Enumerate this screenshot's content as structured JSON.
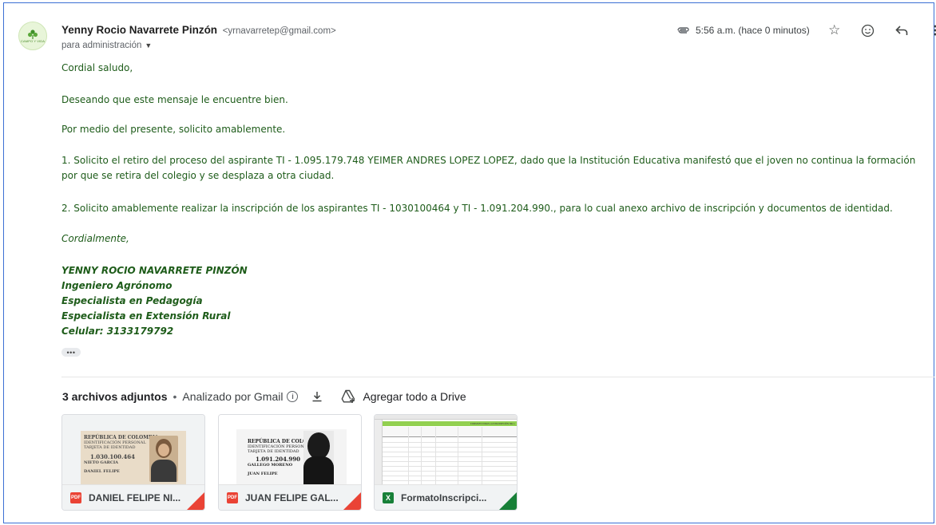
{
  "sender": {
    "name": "Yenny Rocio Navarrete Pinzón",
    "email": "<yrnavarretep@gmail.com>",
    "to": "para administración",
    "avatar_text": "CAMPO Y VIDA"
  },
  "header": {
    "time": "5:56 a.m. (hace 0 minutos)",
    "icons": [
      "attachment-icon",
      "star-icon",
      "emoji-icon",
      "reply-icon",
      "more-vert-icon"
    ]
  },
  "body": {
    "greeting": "Cordial saludo,",
    "line2": "Deseando que este mensaje le encuentre bien.",
    "line3": "Por medio del presente, solicito amablemente.",
    "item1": "1. Solicito el retiro del proceso del aspirante TI - 1.095.179.748 YEIMER ANDRES LOPEZ LOPEZ, dado que la Institución Educativa  manifestó que el joven no continua la formación por que se retira del colegio y se desplaza a otra ciudad.",
    "item2": "2. Solicito amablemente realizar la inscripción de los aspirantes TI - 1030100464 y TI - 1.091.204.990., para lo cual anexo archivo de inscripción y documentos de identidad.",
    "closing": "Cordialmente,",
    "signature": [
      "YENNY ROCIO NAVARRETE PINZÓN",
      "Ingeniero Agrónomo",
      "Especialista en Pedagogía",
      "Especialista en Extensión Rural",
      "Celular: 3133179792"
    ],
    "trimmed": "•••"
  },
  "attachments": {
    "count_label": "3 archivos adjuntos",
    "separator": "•",
    "scanned_label": "Analizado por Gmail",
    "drive_label": "Agregar todo a Drive",
    "files": [
      {
        "name": "DANIEL FELIPE NI...",
        "type": "PDF",
        "thumb_lines": [
          "REPÚBLICA DE COLOMBIA",
          "IDENTIFICACIÓN PERSONAL",
          "TARJETA DE IDENTIDAD",
          "1.030.100.464",
          "NIETO GARCIA",
          "DANIEL FELIPE"
        ]
      },
      {
        "name": "JUAN FELIPE GAL...",
        "type": "PDF",
        "thumb_lines": [
          "REPÚBLICA DE COLOMBIA",
          "IDENTIFICACIÓN PERSONAL",
          "TARJETA DE IDENTIDAD",
          "1.091.204.990",
          "GALLEGO MORENO",
          "JUAN FELIPE"
        ]
      },
      {
        "name": "FormatoInscripci...",
        "type": "X",
        "thumb_lines": [
          "FORMATO PARA LA INSCRIPCIÓN DE L"
        ]
      }
    ]
  },
  "colors": {
    "body_text": "#1e5c1a",
    "pdf": "#ea4335",
    "xls": "#188038",
    "frame": "#3b6fd4"
  }
}
